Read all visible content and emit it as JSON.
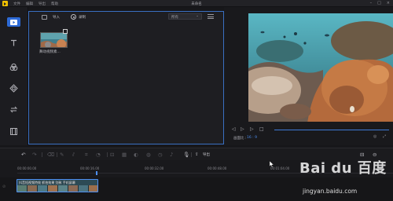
{
  "titlebar": {
    "menu": [
      "文件",
      "编辑",
      "导出",
      "帮助"
    ],
    "title": "未命名"
  },
  "media": {
    "import_label": "导入",
    "record_label": "录制",
    "filter_value": "所有",
    "thumb_label": "舞动视频素..."
  },
  "preview": {
    "ratio_label": "画面比 :",
    "ratio_value": "16 : 9"
  },
  "toolbar": {
    "export_label": "导出"
  },
  "timeline": {
    "timestamps": [
      "00:00:00.00",
      "00:00:16.00",
      "00:00:32.00",
      "00:00:48.00",
      "00:01:04.00"
    ],
    "clip_title": "抖音短视频特效 抓拍效果 别致 手机屏幕"
  },
  "watermark": {
    "logo_text": "Bai du 百度",
    "url": "jingyan.baidu.com"
  },
  "colors": {
    "accent": "#2d6ad6",
    "logo": "#f2c200",
    "ratio": "#4d8ff0"
  }
}
